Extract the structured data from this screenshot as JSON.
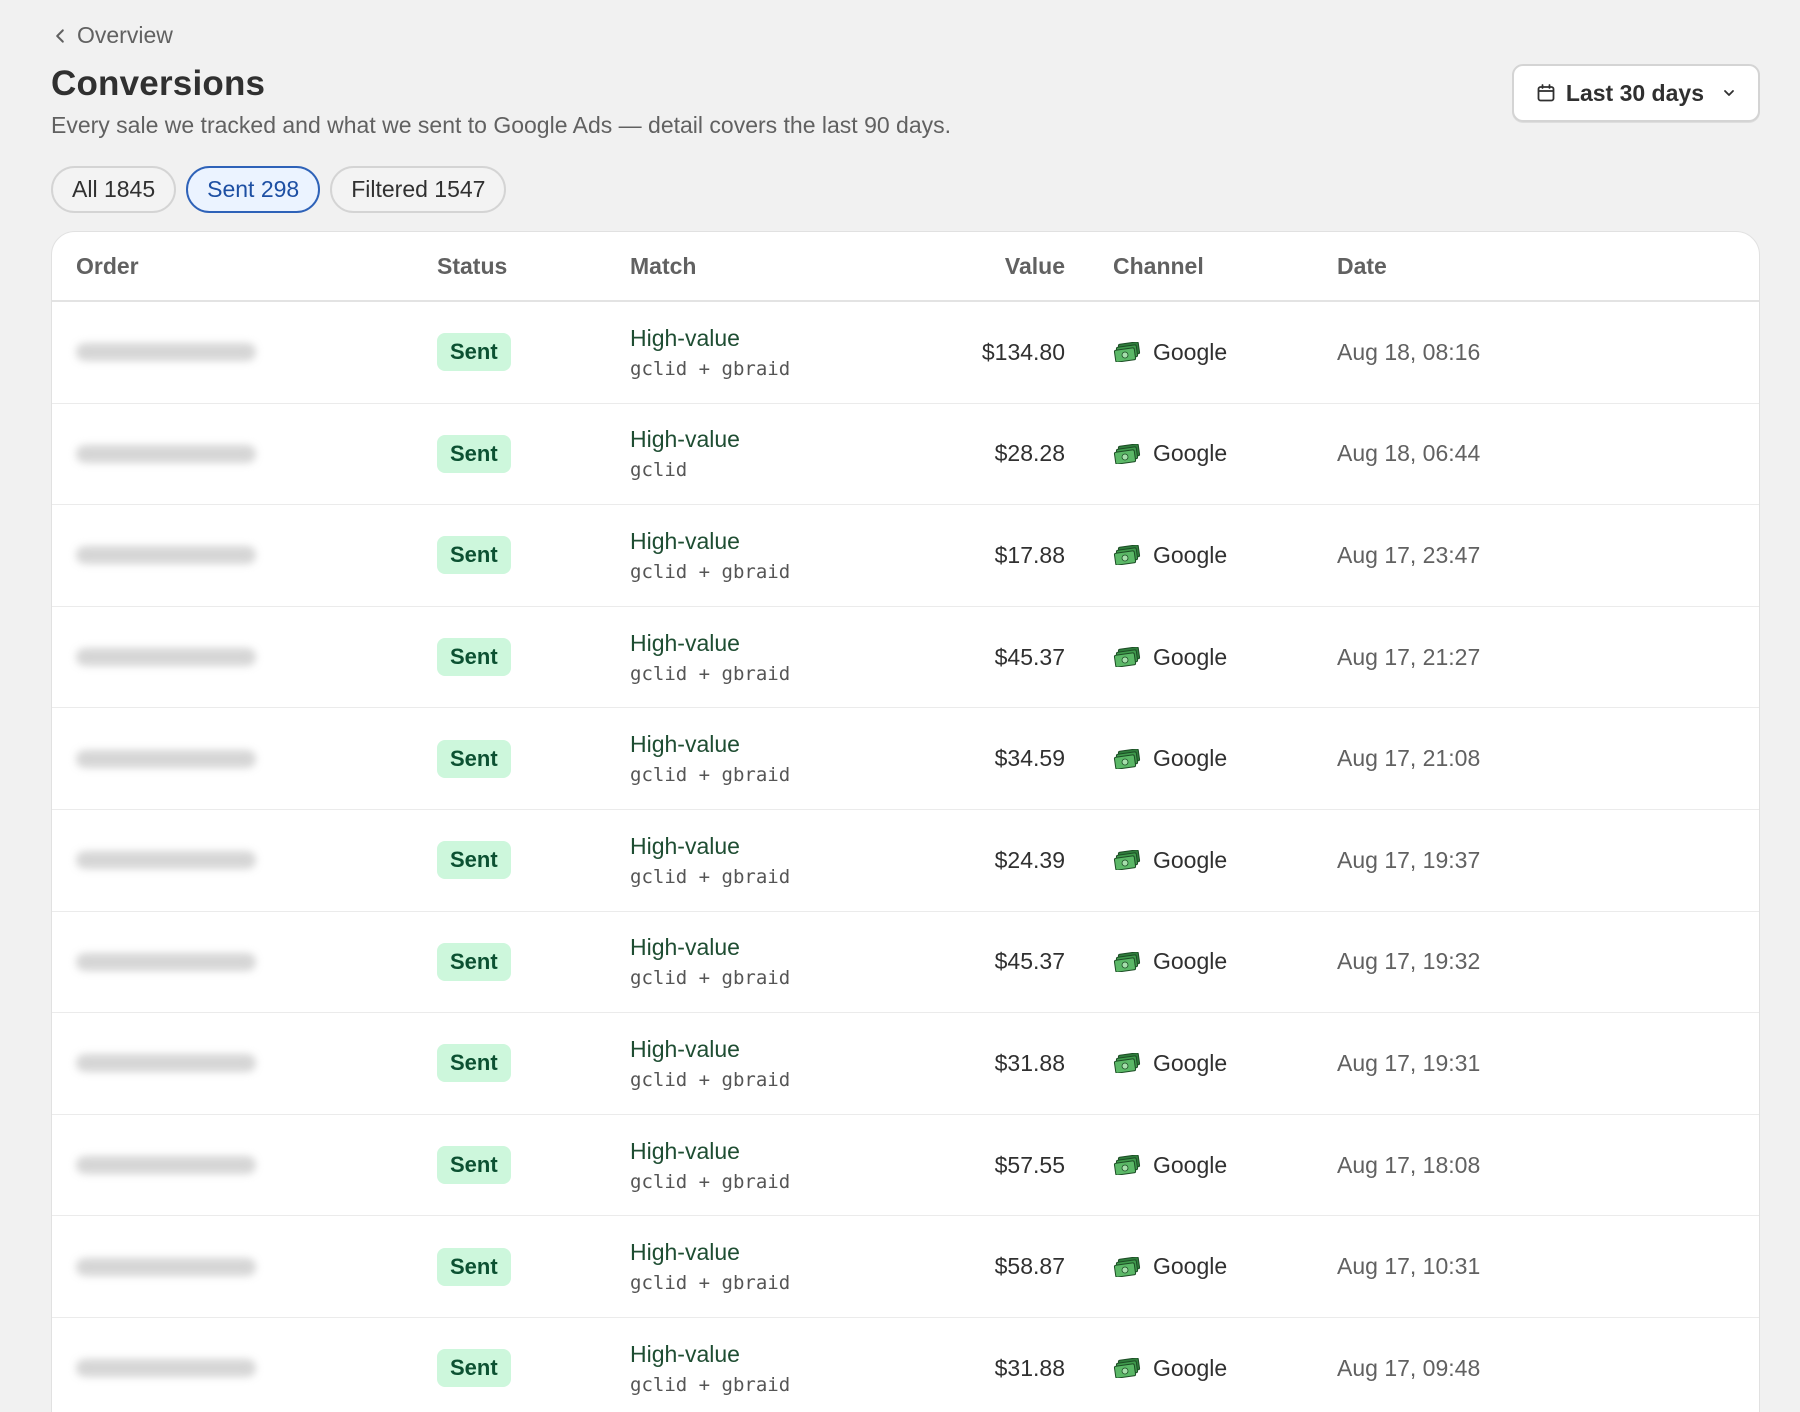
{
  "header": {
    "back_label": "Overview",
    "title": "Conversions",
    "subtitle": "Every sale we tracked and what we sent to Google Ads — detail covers the last 90 days.",
    "date_range": "Last 30 days"
  },
  "tabs": [
    {
      "label": "All 1845",
      "active": false
    },
    {
      "label": "Sent 298",
      "active": true
    },
    {
      "label": "Filtered 1547",
      "active": false
    }
  ],
  "table": {
    "columns": {
      "order": "Order",
      "status": "Status",
      "match": "Match",
      "value": "Value",
      "channel": "Channel",
      "date": "Date"
    },
    "rows": [
      {
        "status": "Sent",
        "match": "High-value",
        "match_ids": "gclid + gbraid",
        "value": "$134.80",
        "channel": "Google",
        "date": "Aug 18, 08:16"
      },
      {
        "status": "Sent",
        "match": "High-value",
        "match_ids": "gclid",
        "value": "$28.28",
        "channel": "Google",
        "date": "Aug 18, 06:44"
      },
      {
        "status": "Sent",
        "match": "High-value",
        "match_ids": "gclid + gbraid",
        "value": "$17.88",
        "channel": "Google",
        "date": "Aug 17, 23:47"
      },
      {
        "status": "Sent",
        "match": "High-value",
        "match_ids": "gclid + gbraid",
        "value": "$45.37",
        "channel": "Google",
        "date": "Aug 17, 21:27"
      },
      {
        "status": "Sent",
        "match": "High-value",
        "match_ids": "gclid + gbraid",
        "value": "$34.59",
        "channel": "Google",
        "date": "Aug 17, 21:08"
      },
      {
        "status": "Sent",
        "match": "High-value",
        "match_ids": "gclid + gbraid",
        "value": "$24.39",
        "channel": "Google",
        "date": "Aug 17, 19:37"
      },
      {
        "status": "Sent",
        "match": "High-value",
        "match_ids": "gclid + gbraid",
        "value": "$45.37",
        "channel": "Google",
        "date": "Aug 17, 19:32"
      },
      {
        "status": "Sent",
        "match": "High-value",
        "match_ids": "gclid + gbraid",
        "value": "$31.88",
        "channel": "Google",
        "date": "Aug 17, 19:31"
      },
      {
        "status": "Sent",
        "match": "High-value",
        "match_ids": "gclid + gbraid",
        "value": "$57.55",
        "channel": "Google",
        "date": "Aug 17, 18:08"
      },
      {
        "status": "Sent",
        "match": "High-value",
        "match_ids": "gclid + gbraid",
        "value": "$58.87",
        "channel": "Google",
        "date": "Aug 17, 10:31"
      },
      {
        "status": "Sent",
        "match": "High-value",
        "match_ids": "gclid + gbraid",
        "value": "$31.88",
        "channel": "Google",
        "date": "Aug 17, 09:48"
      }
    ]
  },
  "icons": {
    "back": "chevron-left-icon",
    "calendar": "calendar-icon",
    "dropdown": "chevron-down-icon",
    "channel": "money-icon"
  },
  "colors": {
    "sent_badge_bg": "#cdf7dc",
    "sent_badge_text": "#0c5132",
    "active_tab_border": "#2e62b8",
    "match_text": "#1e4d32"
  }
}
